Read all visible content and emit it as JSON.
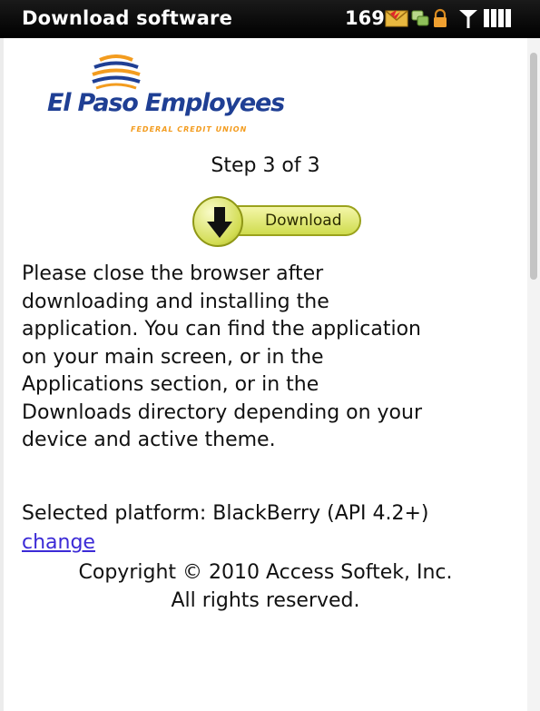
{
  "status_bar": {
    "title": "Download software",
    "count": "169",
    "icons": [
      "mail-icon",
      "bbm-icon",
      "lock-icon",
      "signal-icon",
      "battery-icon"
    ],
    "colors": {
      "background": "#000000",
      "text": "#ffffff"
    }
  },
  "logo": {
    "name": "El Paso Employees",
    "subtitle": "FEDERAL CREDIT UNION",
    "colors": {
      "primary": "#1f3f94",
      "accent": "#f39c1f"
    }
  },
  "step": {
    "text": "Step 3 of 3"
  },
  "download_button": {
    "label": "Download",
    "icon": "download-arrow-icon",
    "color": "#d2dc52"
  },
  "instructions": {
    "lines": [
      "Please close the browser after",
      "downloading and installing the",
      "application. You can find the application",
      "on your main screen, or in the",
      "Applications section, or in the",
      "Downloads directory depending on your",
      "device and active theme."
    ]
  },
  "platform": {
    "text": "Selected platform: BlackBerry (API 4.2+)"
  },
  "change_link": {
    "label": "change",
    "color": "#3b2ad6"
  },
  "copyright": {
    "line1": "Copyright © 2010 Access Softek, Inc.",
    "line2": "All rights reserved."
  }
}
